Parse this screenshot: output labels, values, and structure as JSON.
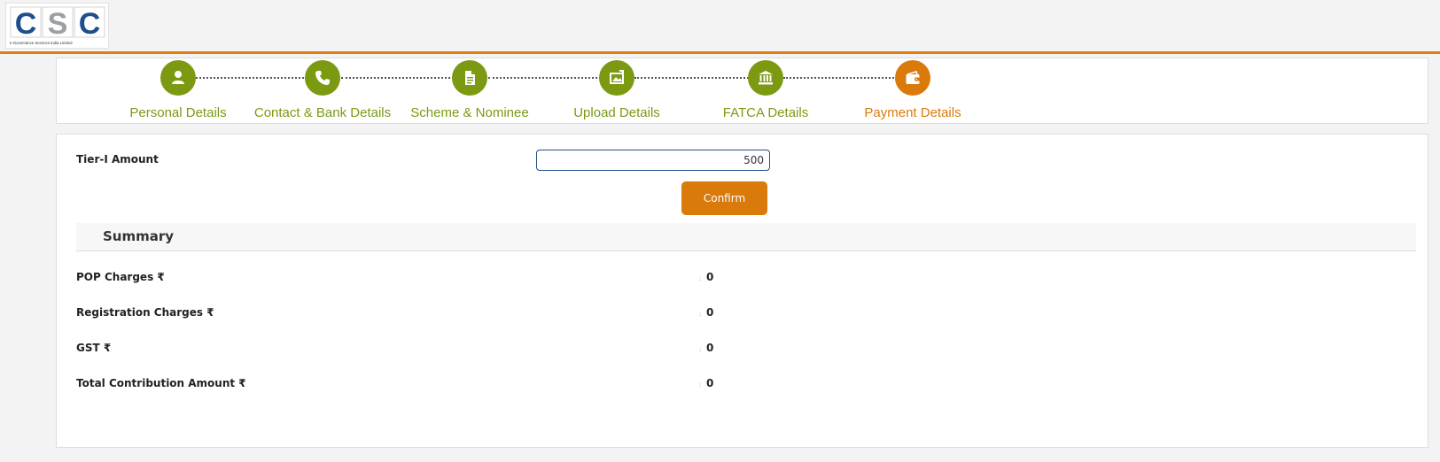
{
  "header": {
    "logo_text": "CSC",
    "logo_subtext": "e-Governance Services India Limited",
    "accent_color": "#e07e12"
  },
  "stepper": {
    "steps": [
      {
        "label": "Personal Details",
        "icon": "person-icon",
        "state": "done"
      },
      {
        "label": "Contact & Bank Details",
        "icon": "phone-icon",
        "state": "done"
      },
      {
        "label": "Scheme & Nominee",
        "icon": "document-icon",
        "state": "done"
      },
      {
        "label": "Upload Details",
        "icon": "upload-image-icon",
        "state": "done"
      },
      {
        "label": "FATCA Details",
        "icon": "bank-icon",
        "state": "done"
      },
      {
        "label": "Payment Details",
        "icon": "wallet-icon",
        "state": "active"
      }
    ],
    "done_color": "#7b9a12",
    "active_color": "#d97a0b"
  },
  "form": {
    "tier_label": "Tier-I Amount",
    "tier_value": "500",
    "confirm_label": "Confirm"
  },
  "summary": {
    "title": "Summary",
    "separator": ":",
    "rows": [
      {
        "label": "POP Charges ₹",
        "value": "0"
      },
      {
        "label": "Registration Charges ₹",
        "value": "0"
      },
      {
        "label": "GST ₹",
        "value": "0"
      },
      {
        "label": "Total Contribution Amount ₹",
        "value": "0"
      }
    ]
  }
}
